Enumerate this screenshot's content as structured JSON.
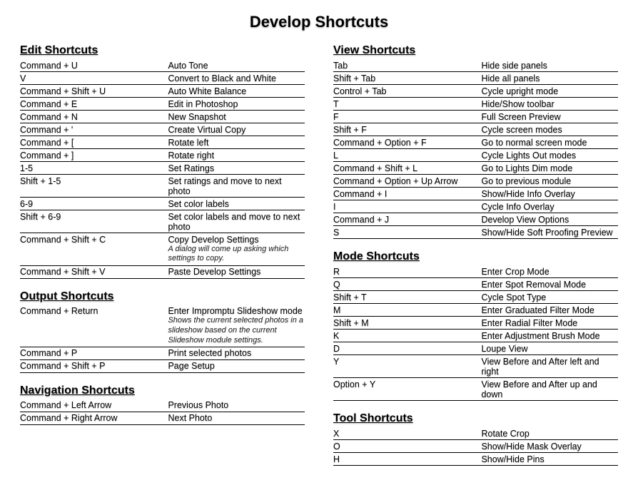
{
  "title": "Develop Shortcuts",
  "left": [
    {
      "title": "Edit Shortcuts",
      "rows": [
        {
          "key": "Command + U",
          "desc": "Auto Tone"
        },
        {
          "key": "V",
          "desc": "Convert to Black and White"
        },
        {
          "key": "Command + Shift + U",
          "desc": "Auto White Balance"
        },
        {
          "key": "Command + E",
          "desc": "Edit in Photoshop"
        },
        {
          "key": "Command + N",
          "desc": "New Snapshot"
        },
        {
          "key": "Command + '",
          "desc": "Create Virtual Copy"
        },
        {
          "key": "Command + [",
          "desc": "Rotate left"
        },
        {
          "key": "Command + ]",
          "desc": "Rotate right"
        },
        {
          "key": "1-5",
          "desc": "Set Ratings"
        },
        {
          "key": "Shift + 1-5",
          "desc": "Set ratings and move to next photo"
        },
        {
          "key": "6-9",
          "desc": "Set color labels"
        },
        {
          "key": "Shift + 6-9",
          "desc": "Set color labels and move to next photo"
        },
        {
          "key": "Command + Shift + C",
          "desc": "Copy Develop Settings",
          "note": "A dialog will come up asking which settings to copy."
        },
        {
          "key": "Command + Shift + V",
          "desc": "Paste Develop Settings"
        }
      ]
    },
    {
      "title": "Output Shortcuts",
      "rows": [
        {
          "key": "Command + Return",
          "desc": "Enter Impromptu Slideshow mode",
          "note": "Shows the current selected photos in a slideshow based on the current Slideshow module settings."
        },
        {
          "key": "Command + P",
          "desc": "Print selected photos"
        },
        {
          "key": "Command + Shift + P",
          "desc": "Page Setup"
        }
      ]
    },
    {
      "title": "Navigation Shortcuts",
      "rows": [
        {
          "key": "Command + Left Arrow",
          "desc": "Previous Photo"
        },
        {
          "key": "Command + Right Arrow",
          "desc": "Next Photo"
        }
      ]
    }
  ],
  "right": [
    {
      "title": "View Shortcuts",
      "rows": [
        {
          "key": "Tab",
          "desc": "Hide side panels"
        },
        {
          "key": "Shift + Tab",
          "desc": "Hide all panels"
        },
        {
          "key": "Control + Tab",
          "desc": "Cycle upright mode"
        },
        {
          "key": "T",
          "desc": "Hide/Show toolbar"
        },
        {
          "key": "F",
          "desc": "Full Screen Preview"
        },
        {
          "key": "Shift + F",
          "desc": "Cycle screen modes"
        },
        {
          "key": "Command + Option + F",
          "desc": "Go to normal screen mode"
        },
        {
          "key": "L",
          "desc": "Cycle Lights Out modes"
        },
        {
          "key": "Command + Shift + L",
          "desc": "Go to Lights Dim mode"
        },
        {
          "key": "Command + Option + Up Arrow",
          "desc": "Go to previous module"
        },
        {
          "key": "Command + I",
          "desc": "Show/Hide Info Overlay"
        },
        {
          "key": "I",
          "desc": "Cycle Info Overlay"
        },
        {
          "key": "Command + J",
          "desc": "Develop View Options"
        },
        {
          "key": "S",
          "desc": "Show/Hide Soft Proofing Preview"
        }
      ]
    },
    {
      "title": "Mode Shortcuts",
      "rows": [
        {
          "key": "R",
          "desc": "Enter Crop Mode"
        },
        {
          "key": "Q",
          "desc": "Enter Spot Removal Mode"
        },
        {
          "key": "Shift + T",
          "desc": "Cycle Spot Type"
        },
        {
          "key": "M",
          "desc": "Enter Graduated Filter Mode"
        },
        {
          "key": "Shift + M",
          "desc": "Enter Radial Filter Mode"
        },
        {
          "key": "K",
          "desc": "Enter Adjustment Brush Mode"
        },
        {
          "key": "D",
          "desc": "Loupe View"
        },
        {
          "key": "Y",
          "desc": "View Before and After left and right"
        },
        {
          "key": "Option + Y",
          "desc": "View Before and After up and down"
        }
      ]
    },
    {
      "title": "Tool Shortcuts",
      "rows": [
        {
          "key": "X",
          "desc": "Rotate Crop"
        },
        {
          "key": "O",
          "desc": "Show/Hide Mask Overlay"
        },
        {
          "key": "H",
          "desc": "Show/Hide Pins"
        }
      ]
    }
  ]
}
